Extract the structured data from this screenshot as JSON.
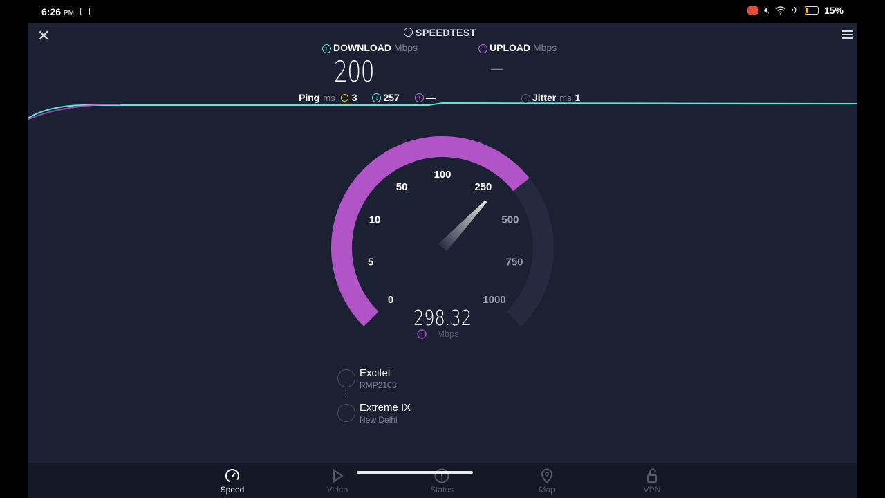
{
  "status": {
    "time": "6:26",
    "ampm": "PM",
    "battery": "15%"
  },
  "header": {
    "title": "SPEEDTEST"
  },
  "download": {
    "label": "DOWNLOAD",
    "unit": "Mbps",
    "value": "200"
  },
  "upload": {
    "label": "UPLOAD",
    "unit": "Mbps",
    "value": "—"
  },
  "ping": {
    "label": "Ping",
    "unit": "ms",
    "idle": "3",
    "download": "257",
    "upload": "—"
  },
  "jitter": {
    "label": "Jitter",
    "unit": "ms",
    "value": "1"
  },
  "gauge": {
    "ticks": [
      "0",
      "5",
      "10",
      "50",
      "100",
      "250",
      "500",
      "750",
      "1000"
    ],
    "reading": "298.32",
    "unit": "Mbps",
    "fill_fraction": 0.69,
    "needle_fraction": 0.66,
    "fill_color": "#b054c7",
    "track_color": "#252a40"
  },
  "connection": {
    "isp_name": "Excitel",
    "isp_sub": "RMP2103",
    "server_name": "Extreme IX",
    "server_location": "New Delhi"
  },
  "nav": [
    {
      "label": "Speed",
      "icon": "speedometer-icon",
      "active": true
    },
    {
      "label": "Video",
      "icon": "play-icon",
      "active": false
    },
    {
      "label": "Status",
      "icon": "alert-icon",
      "active": false
    },
    {
      "label": "Map",
      "icon": "map-pin-icon",
      "active": false
    },
    {
      "label": "VPN",
      "icon": "lock-icon",
      "active": false
    }
  ],
  "colors": {
    "download": "#5fe3dd",
    "upload": "#c46be0",
    "background": "#1c2033"
  }
}
